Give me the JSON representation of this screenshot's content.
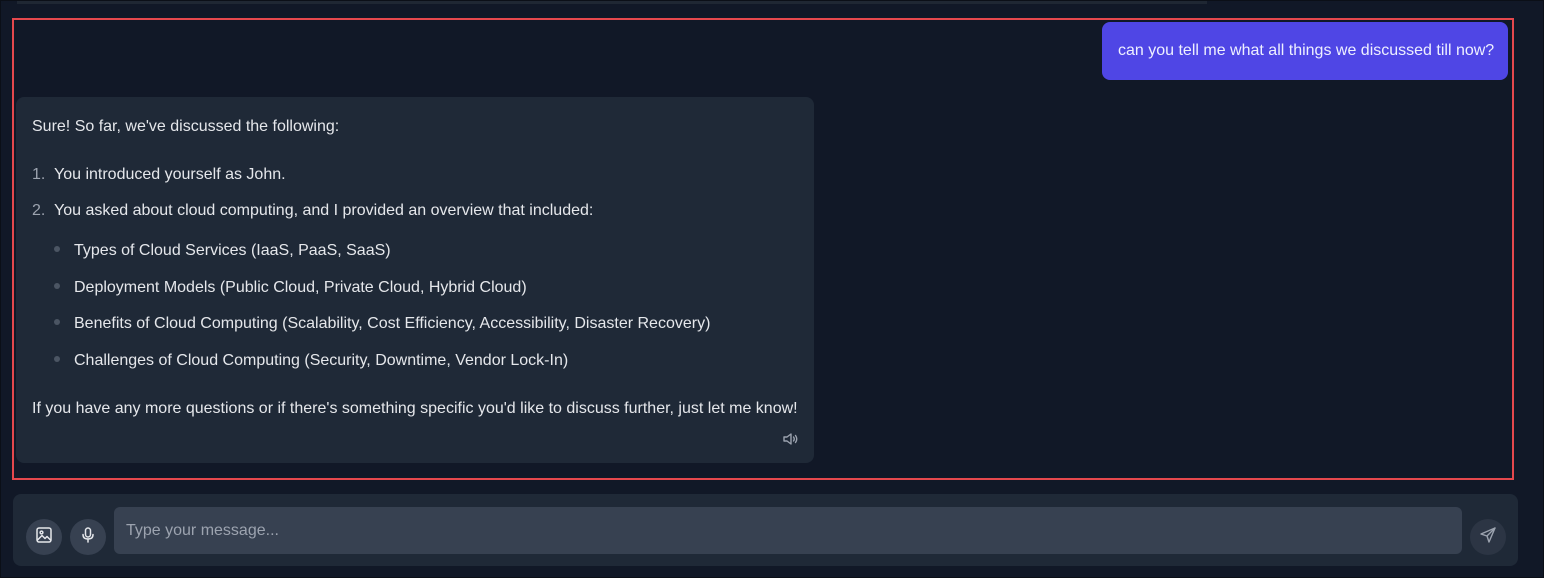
{
  "user_message": {
    "text": "can you tell me what all things we discussed till now?"
  },
  "assistant_message": {
    "intro": "Sure! So far, we've discussed the following:",
    "ordered_items": [
      {
        "number": "1.",
        "text": "You introduced yourself as John."
      },
      {
        "number": "2.",
        "text": "You asked about cloud computing, and I provided an overview that included:"
      }
    ],
    "bullet_items": [
      "Types of Cloud Services (IaaS, PaaS, SaaS)",
      "Deployment Models (Public Cloud, Private Cloud, Hybrid Cloud)",
      "Benefits of Cloud Computing (Scalability, Cost Efficiency, Accessibility, Disaster Recovery)",
      "Challenges of Cloud Computing (Security, Downtime, Vendor Lock-In)"
    ],
    "outro": "If you have any more questions or if there's something specific you'd like to discuss further, just let me know!",
    "speaker_icon": "speaker-icon"
  },
  "composer": {
    "placeholder": "Type your message...",
    "image_icon": "image-icon",
    "mic_icon": "microphone-icon",
    "send_icon": "send-icon"
  },
  "colors": {
    "background": "#111827",
    "user_bubble": "#4f46e5",
    "assistant_bubble": "#1f2937",
    "highlight_border": "#e5484d",
    "input_field": "#374151"
  }
}
